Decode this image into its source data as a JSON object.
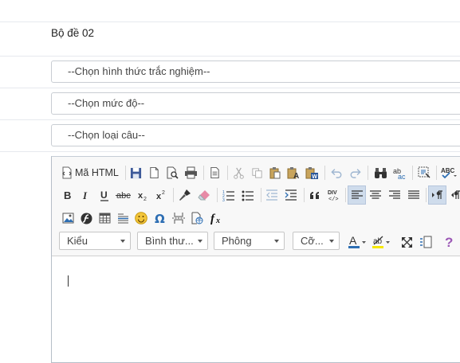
{
  "form": {
    "exam_set": "Bộ đề 02",
    "test_type_placeholder": "--Chọn hình thức trắc nghiệm--",
    "level_placeholder": "--Chọn mức độ--",
    "question_type_placeholder": "--Chọn loại câu--"
  },
  "editor": {
    "source_label": "Mã HTML",
    "style_combo": "Kiểu",
    "format_combo": "Bình thư...",
    "font_combo": "Phông",
    "size_combo": "Cỡ...",
    "accent_color": "#2d6eb3",
    "active_color": "#cfdcec"
  }
}
